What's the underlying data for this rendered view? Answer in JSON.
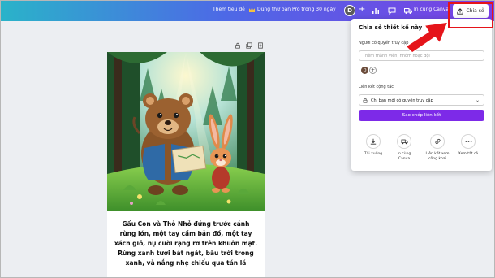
{
  "topbar": {
    "resize_label": "Thêm tiêu đề",
    "pro_trial_label": "Dùng thử bản Pro trong 30 ngày",
    "avatar_initial": "D",
    "print_label": "In cùng Canva",
    "share_label": "Chia sẻ",
    "gradient_colors": [
      "#2ab3c9",
      "#4d69e6",
      "#7b3fe4"
    ]
  },
  "page": {
    "caption": "Gấu Con và Thỏ Nhỏ đứng trước cánh rừng lớn, một tay cầm bản đồ, một tay xách giỏ, nụ cười rạng rỡ trên khuôn mặt. Rừng xanh tươi bát ngát, bầu trời trong xanh, và nắng nhẹ chiếu qua tán lá"
  },
  "share_panel": {
    "title": "Chia sẻ thiết kế này",
    "people_label": "Người có quyền truy cập",
    "people_input_placeholder": "Thêm thành viên, nhóm hoặc đội",
    "member_initial": "D",
    "link_label": "Liên kết cộng tác",
    "link_access": "Chỉ bạn mới có quyền truy cập",
    "copy_link_label": "Sao chép liên kết",
    "accent_color": "#7d2ae8",
    "options": [
      {
        "label": "Tải xuống",
        "icon": "download-icon"
      },
      {
        "label": "In cùng Canva",
        "icon": "truck-icon"
      },
      {
        "label": "Liên kết xem công khai",
        "icon": "link-icon"
      },
      {
        "label": "Xem tất cả",
        "icon": "more-icon"
      }
    ]
  },
  "annotation": {
    "arrow_color": "#e5141a"
  }
}
